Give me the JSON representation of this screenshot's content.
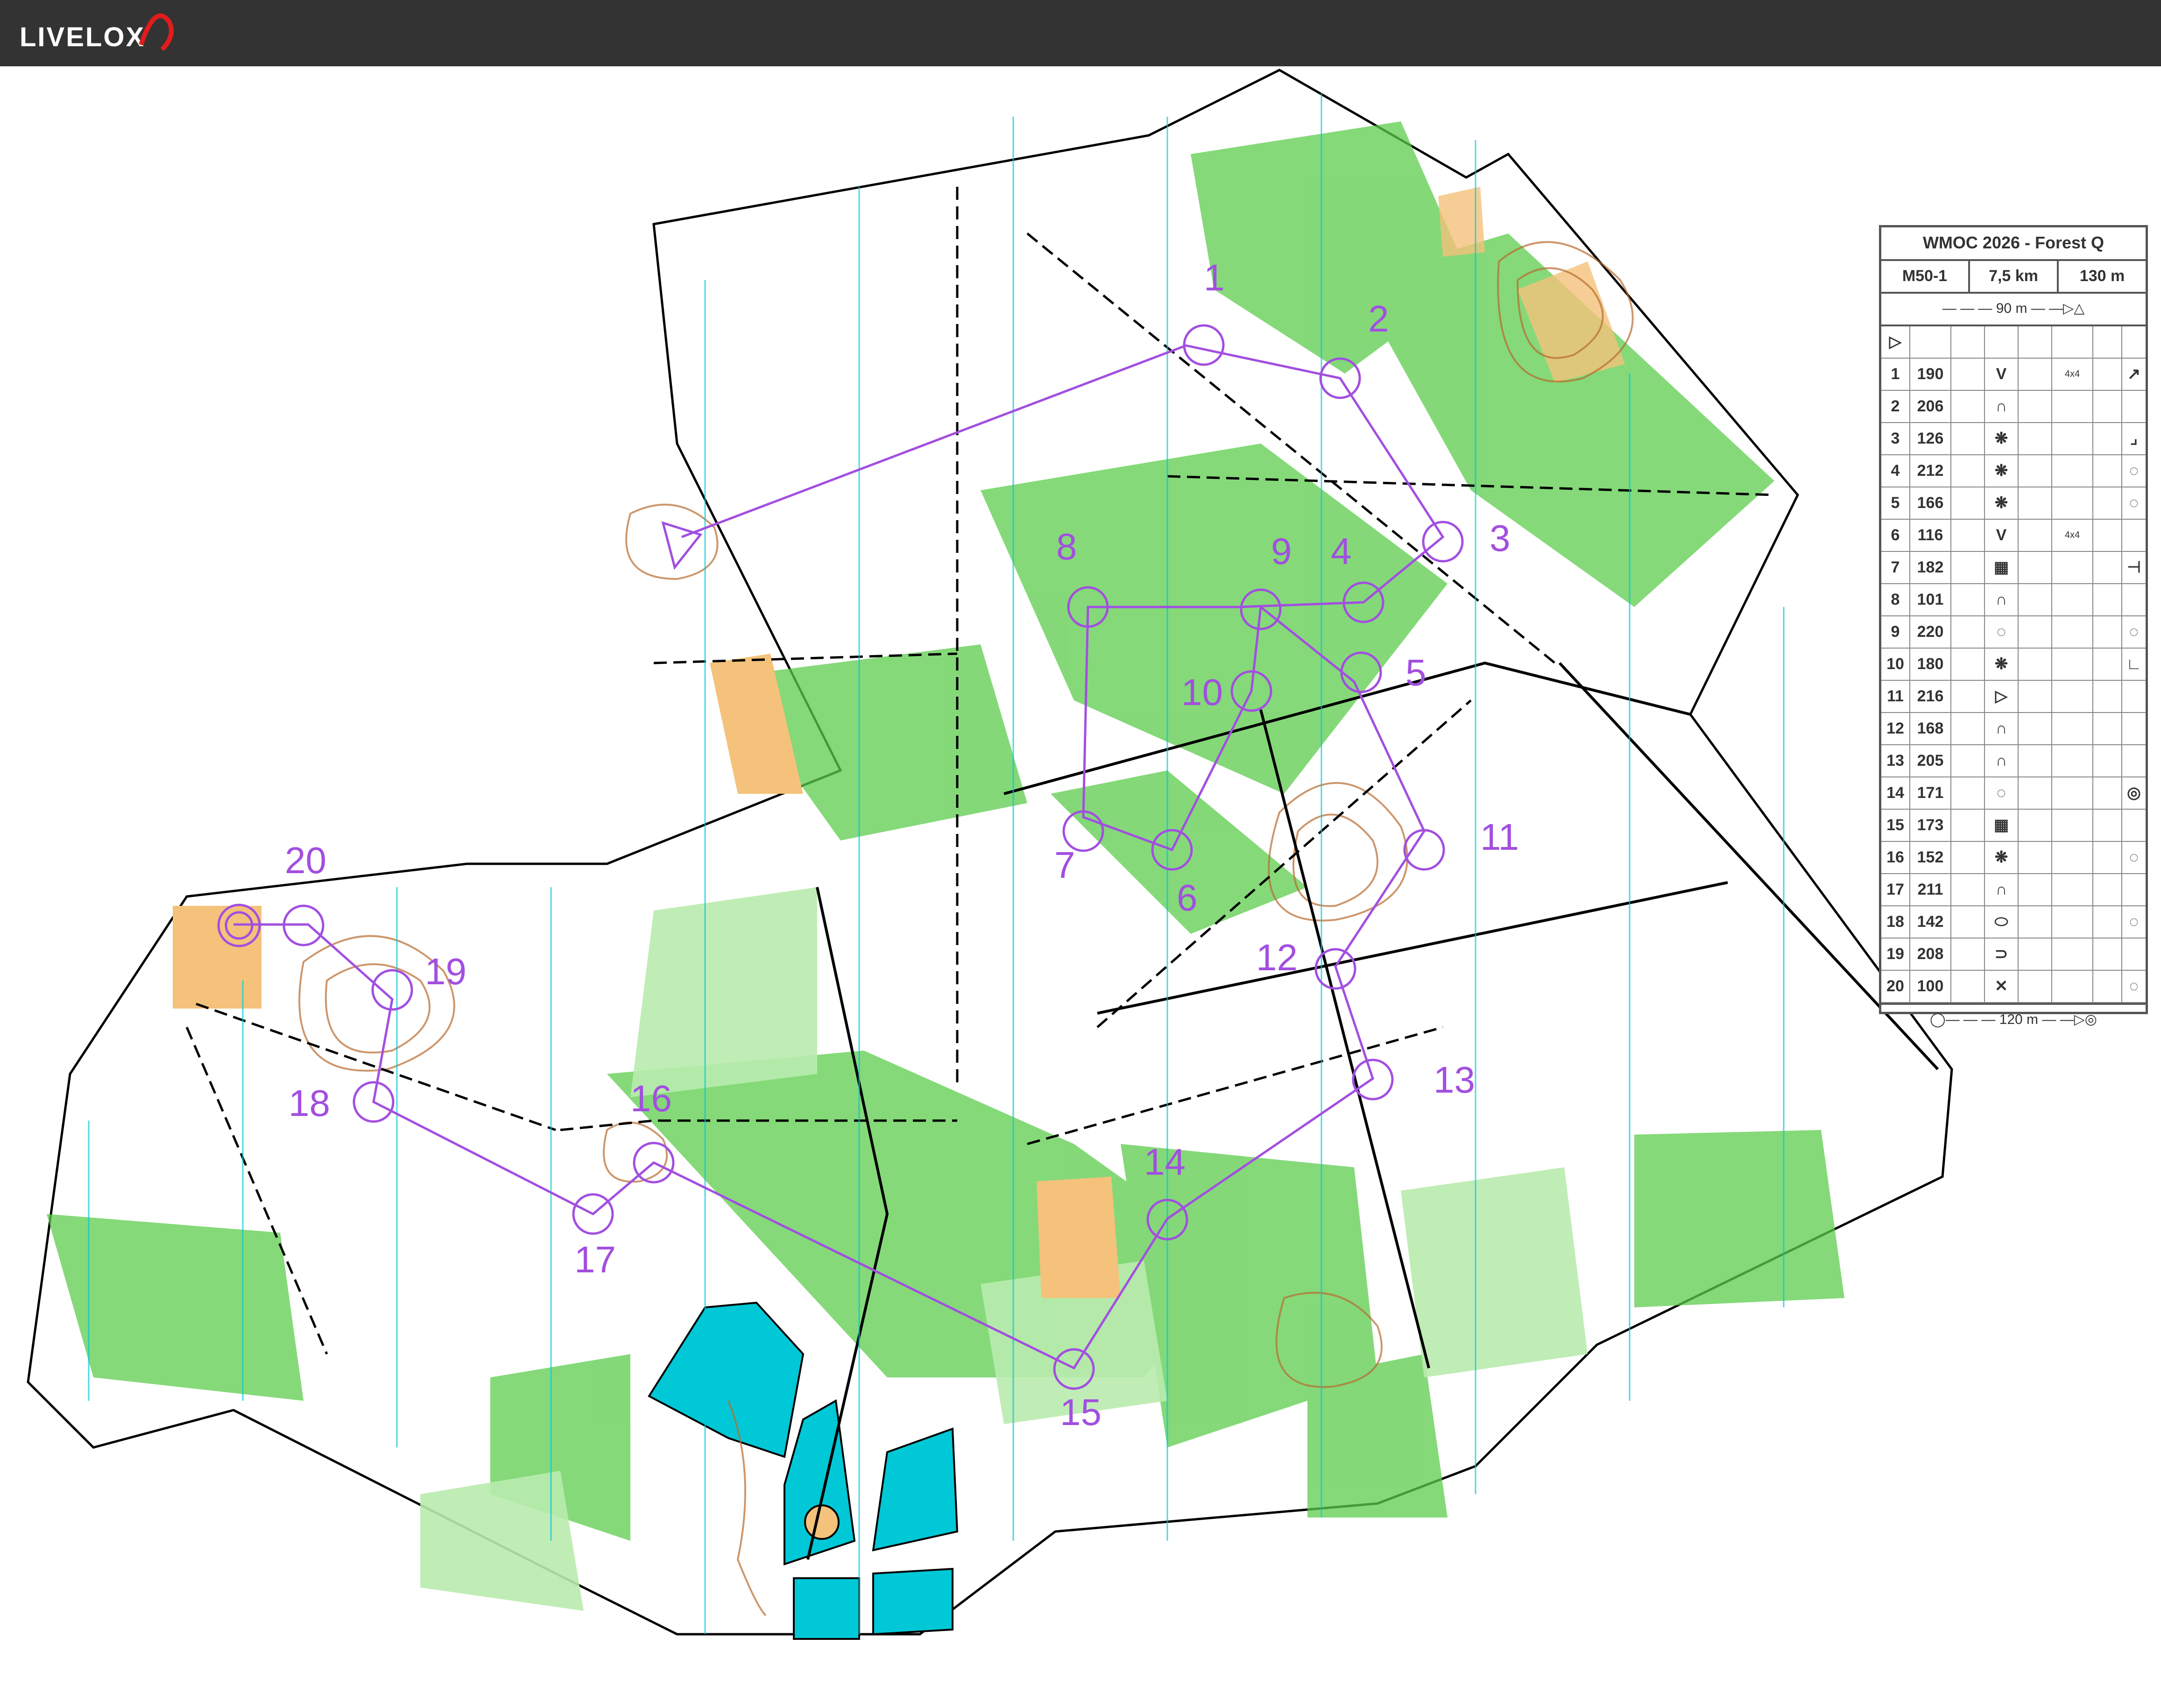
{
  "app": {
    "logo": "LIVELOX"
  },
  "course_panel": {
    "event": "WMOC 2026 - Forest Q",
    "class": "M50-1",
    "length": "7,5 km",
    "climb": "130 m",
    "start_tape": "90 m",
    "finish_tape": "120 m",
    "controls": [
      {
        "n": "1",
        "code": "190",
        "feature": "V",
        "detail": "4x4",
        "where": "↗"
      },
      {
        "n": "2",
        "code": "206",
        "feature": "∩",
        "detail": "",
        "where": ""
      },
      {
        "n": "3",
        "code": "126",
        "feature": "❋",
        "detail": "",
        "where": "⌟"
      },
      {
        "n": "4",
        "code": "212",
        "feature": "❋",
        "detail": "",
        "where": "◌"
      },
      {
        "n": "5",
        "code": "166",
        "feature": "❋",
        "detail": "",
        "where": "◌"
      },
      {
        "n": "6",
        "code": "116",
        "feature": "V",
        "detail": "4x4",
        "where": ""
      },
      {
        "n": "7",
        "code": "182",
        "feature": "▦",
        "detail": "",
        "where": "⊣"
      },
      {
        "n": "8",
        "code": "101",
        "feature": "∩",
        "detail": "",
        "where": ""
      },
      {
        "n": "9",
        "code": "220",
        "feature": "◌",
        "detail": "",
        "where": "◌"
      },
      {
        "n": "10",
        "code": "180",
        "feature": "❋",
        "detail": "",
        "where": "∟"
      },
      {
        "n": "11",
        "code": "216",
        "feature": "▷",
        "detail": "",
        "where": ""
      },
      {
        "n": "12",
        "code": "168",
        "feature": "∩",
        "detail": "",
        "where": ""
      },
      {
        "n": "13",
        "code": "205",
        "feature": "∩",
        "detail": "",
        "where": ""
      },
      {
        "n": "14",
        "code": "171",
        "feature": "◌",
        "detail": "",
        "where": "◎"
      },
      {
        "n": "15",
        "code": "173",
        "feature": "▦",
        "detail": "",
        "where": ""
      },
      {
        "n": "16",
        "code": "152",
        "feature": "❋",
        "detail": "",
        "where": "◌"
      },
      {
        "n": "17",
        "code": "211",
        "feature": "∩",
        "detail": "",
        "where": ""
      },
      {
        "n": "18",
        "code": "142",
        "feature": "⬭",
        "detail": "",
        "where": "◌"
      },
      {
        "n": "19",
        "code": "208",
        "feature": "⊃",
        "detail": "",
        "where": ""
      },
      {
        "n": "20",
        "code": "100",
        "feature": "✕",
        "detail": "",
        "where": "◌"
      }
    ]
  },
  "map": {
    "course_color": "#a24fe0",
    "water_color": "#00c8d6",
    "green_color": "#5ccc4c",
    "open_color": "#f4c27a",
    "labels": [
      "1",
      "2",
      "3",
      "4",
      "5",
      "6",
      "7",
      "8",
      "9",
      "10",
      "11",
      "12",
      "13",
      "14",
      "15",
      "16",
      "17",
      "18",
      "19",
      "20"
    ]
  }
}
